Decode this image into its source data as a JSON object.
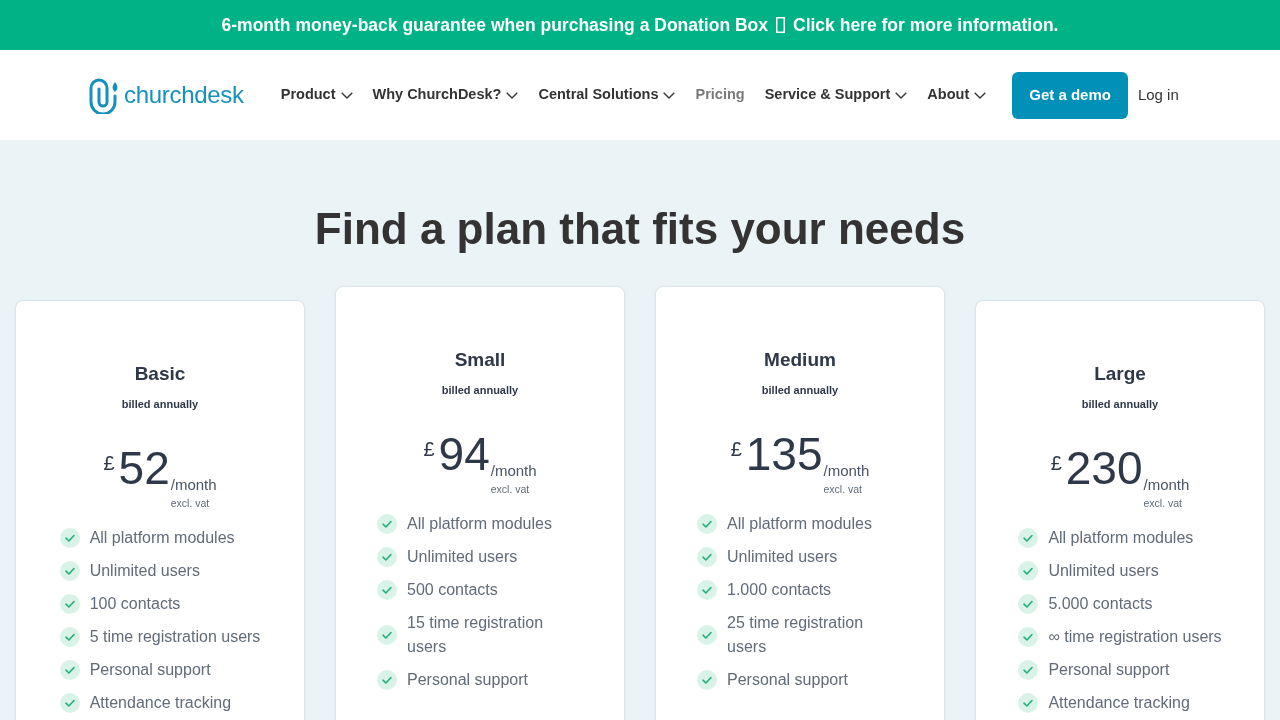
{
  "banner": {
    "text": "6-month money-back guarantee when purchasing a Donation Box",
    "link": "Click here for more information."
  },
  "header": {
    "logo_text": "churchdesk",
    "nav": [
      {
        "label": "Product",
        "dropdown": true,
        "selected": false
      },
      {
        "label": "Why ChurchDesk?",
        "dropdown": true,
        "selected": false
      },
      {
        "label": "Central Solutions",
        "dropdown": true,
        "selected": false
      },
      {
        "label": "Pricing",
        "dropdown": false,
        "selected": true
      },
      {
        "label": "Service & Support",
        "dropdown": true,
        "selected": false
      },
      {
        "label": "About",
        "dropdown": true,
        "selected": false
      }
    ],
    "cta": "Get a demo",
    "login": "Log in"
  },
  "heading": "Find a plan that fits your needs",
  "plans": [
    {
      "name": "Basic",
      "billing": "billed annually",
      "currency": "£",
      "price": "52",
      "period": "/month",
      "tax_note": "excl. vat",
      "raised": false,
      "features": [
        "All platform modules",
        "Unlimited users",
        "100 contacts",
        "5 time registration users",
        "Personal support",
        "Attendance tracking"
      ]
    },
    {
      "name": "Small",
      "billing": "billed annually",
      "currency": "£",
      "price": "94",
      "period": "/month",
      "tax_note": "excl. vat",
      "raised": true,
      "features": [
        "All platform modules",
        "Unlimited users",
        "500 contacts",
        "15 time registration users",
        "Personal support"
      ]
    },
    {
      "name": "Medium",
      "billing": "billed annually",
      "currency": "£",
      "price": "135",
      "period": "/month",
      "tax_note": "excl. vat",
      "raised": true,
      "features": [
        "All platform modules",
        "Unlimited users",
        "1.000 contacts",
        "25 time registration users",
        "Personal support"
      ]
    },
    {
      "name": "Large",
      "billing": "billed annually",
      "currency": "£",
      "price": "230",
      "period": "/month",
      "tax_note": "excl. vat",
      "raised": false,
      "features": [
        "All platform modules",
        "Unlimited users",
        "5.000 contacts",
        "∞ time registration users",
        "Personal support",
        "Attendance tracking"
      ]
    }
  ]
}
